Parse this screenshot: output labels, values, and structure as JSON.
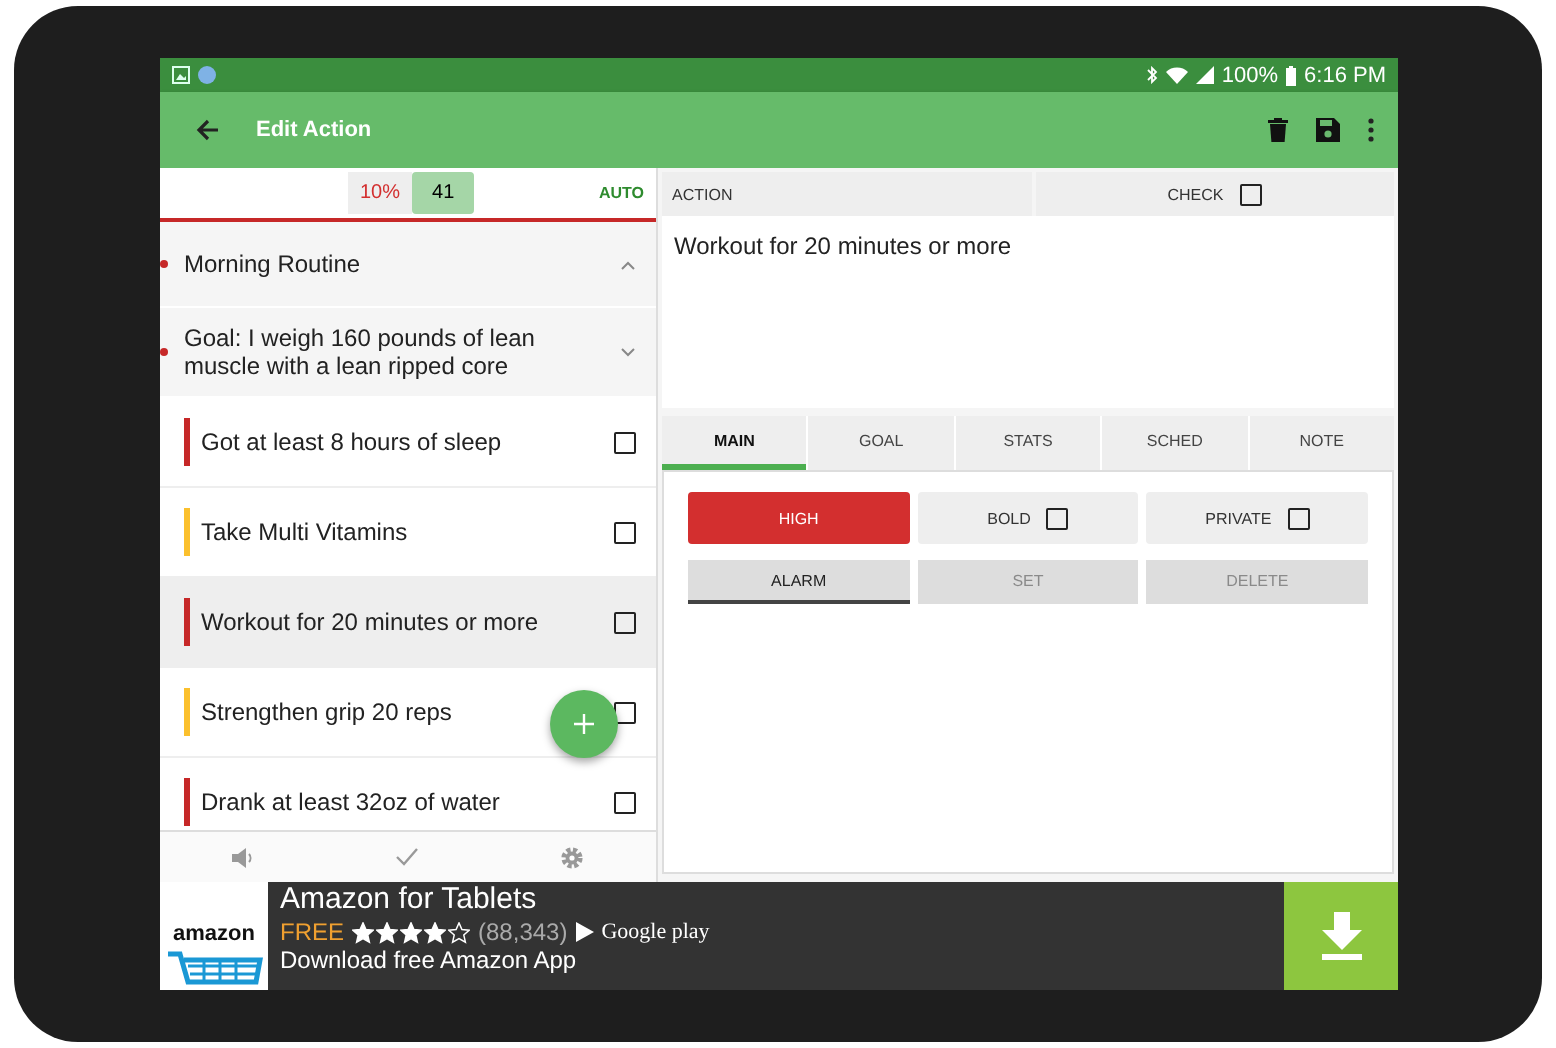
{
  "status_bar": {
    "battery": "100%",
    "time": "6:16 PM"
  },
  "toolbar": {
    "title": "Edit Action"
  },
  "list_header": {
    "percent": "10%",
    "count": "41",
    "mode": "AUTO"
  },
  "items": [
    {
      "kind": "group",
      "label": "Morning Routine",
      "expanded": true,
      "children": [
        {
          "kind": "group",
          "label": "Goal: I weigh 160 pounds of lean muscle with a lean ripped core",
          "expanded": false,
          "children": [
            {
              "kind": "task",
              "label": "Got at least 8 hours of sleep",
              "color": "#c62828",
              "checked": false,
              "selected": false
            },
            {
              "kind": "task",
              "label": "Take Multi Vitamins",
              "color": "#fbc02d",
              "checked": false,
              "selected": false
            },
            {
              "kind": "task",
              "label": "Workout for 20 minutes or more",
              "color": "#c62828",
              "checked": false,
              "selected": true
            },
            {
              "kind": "task",
              "label": "Strengthen grip 20 reps",
              "color": "#fbc02d",
              "checked": false,
              "selected": false
            },
            {
              "kind": "task",
              "label": "Drank at least 32oz of water",
              "color": "#c62828",
              "checked": false,
              "selected": false
            }
          ]
        }
      ]
    }
  ],
  "action": {
    "label": "ACTION",
    "check_label": "CHECK",
    "checked": false,
    "value": "Workout for 20 minutes or more"
  },
  "tabs": [
    {
      "label": "MAIN",
      "selected": true
    },
    {
      "label": "GOAL",
      "selected": false
    },
    {
      "label": "STATS",
      "selected": false
    },
    {
      "label": "SCHED",
      "selected": false
    },
    {
      "label": "NOTE",
      "selected": false
    }
  ],
  "options": [
    {
      "kind": "priority",
      "label": "HIGH"
    },
    {
      "kind": "check",
      "label": "BOLD",
      "checked": false
    },
    {
      "kind": "check",
      "label": "PRIVATE",
      "checked": false
    }
  ],
  "alarm_buttons": [
    {
      "label": "ALARM",
      "disabled": false
    },
    {
      "label": "SET",
      "disabled": true
    },
    {
      "label": "DELETE",
      "disabled": true
    }
  ],
  "ad": {
    "logo": "amazon",
    "title": "Amazon for Tablets",
    "price": "FREE",
    "stars": 4,
    "reviews": "(88,343)",
    "store": "Google play",
    "description": "Download free Amazon App"
  }
}
